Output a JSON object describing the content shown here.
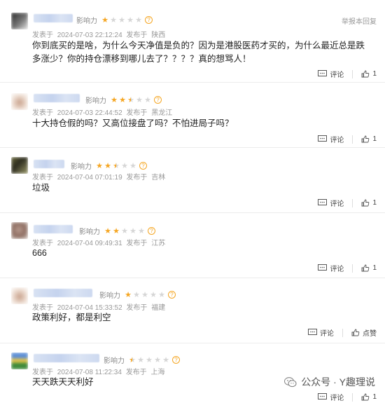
{
  "report_label": "举报本回复",
  "influence_label": "影响力",
  "comments": [
    {
      "rating": 1.0,
      "published_label": "发表于",
      "time": "2024-07-03 22:12:24",
      "location_label": "发布于",
      "location": "陕西",
      "text": "你到底买的是啥，为什么今天净值是负的？因为是港股医药才买的，为什么最近总是跌多涨少？你的持仓漂移到哪儿去了？？？？真的想骂人！",
      "reply_label": "评论",
      "like_count": "1"
    },
    {
      "rating": 2.5,
      "published_label": "发表于",
      "time": "2024-07-03 22:44:52",
      "location_label": "发布于",
      "location": "黑龙江",
      "text": "十大持仓假的吗？又高位接盘了吗？不怕进局子吗？",
      "reply_label": "评论",
      "like_count": "1"
    },
    {
      "rating": 2.5,
      "published_label": "发表于",
      "time": "2024-07-04 07:01:19",
      "location_label": "发布于",
      "location": "吉林",
      "text": "垃圾",
      "reply_label": "评论",
      "like_count": "1"
    },
    {
      "rating": 2.0,
      "published_label": "发表于",
      "time": "2024-07-04 09:49:31",
      "location_label": "发布于",
      "location": "江苏",
      "text": "666",
      "reply_label": "评论",
      "like_count": "1"
    },
    {
      "rating": 1.0,
      "published_label": "发表于",
      "time": "2024-07-04 15:33:52",
      "location_label": "发布于",
      "location": "福建",
      "text": "政策利好，都是利空",
      "reply_label": "评论",
      "like_count": "点赞"
    },
    {
      "rating": 0.5,
      "published_label": "发表于",
      "time": "2024-07-08 11:22:34",
      "location_label": "发布于",
      "location": "上海",
      "text": "天天跌天天利好",
      "reply_label": "评论",
      "like_count": "1"
    }
  ],
  "watermark": "公众号 · Y趣理说",
  "colors": {
    "star": "#f5a623",
    "star_empty": "#d6d6d6",
    "meta": "#999999",
    "username_blur": "#c5d3ee"
  }
}
